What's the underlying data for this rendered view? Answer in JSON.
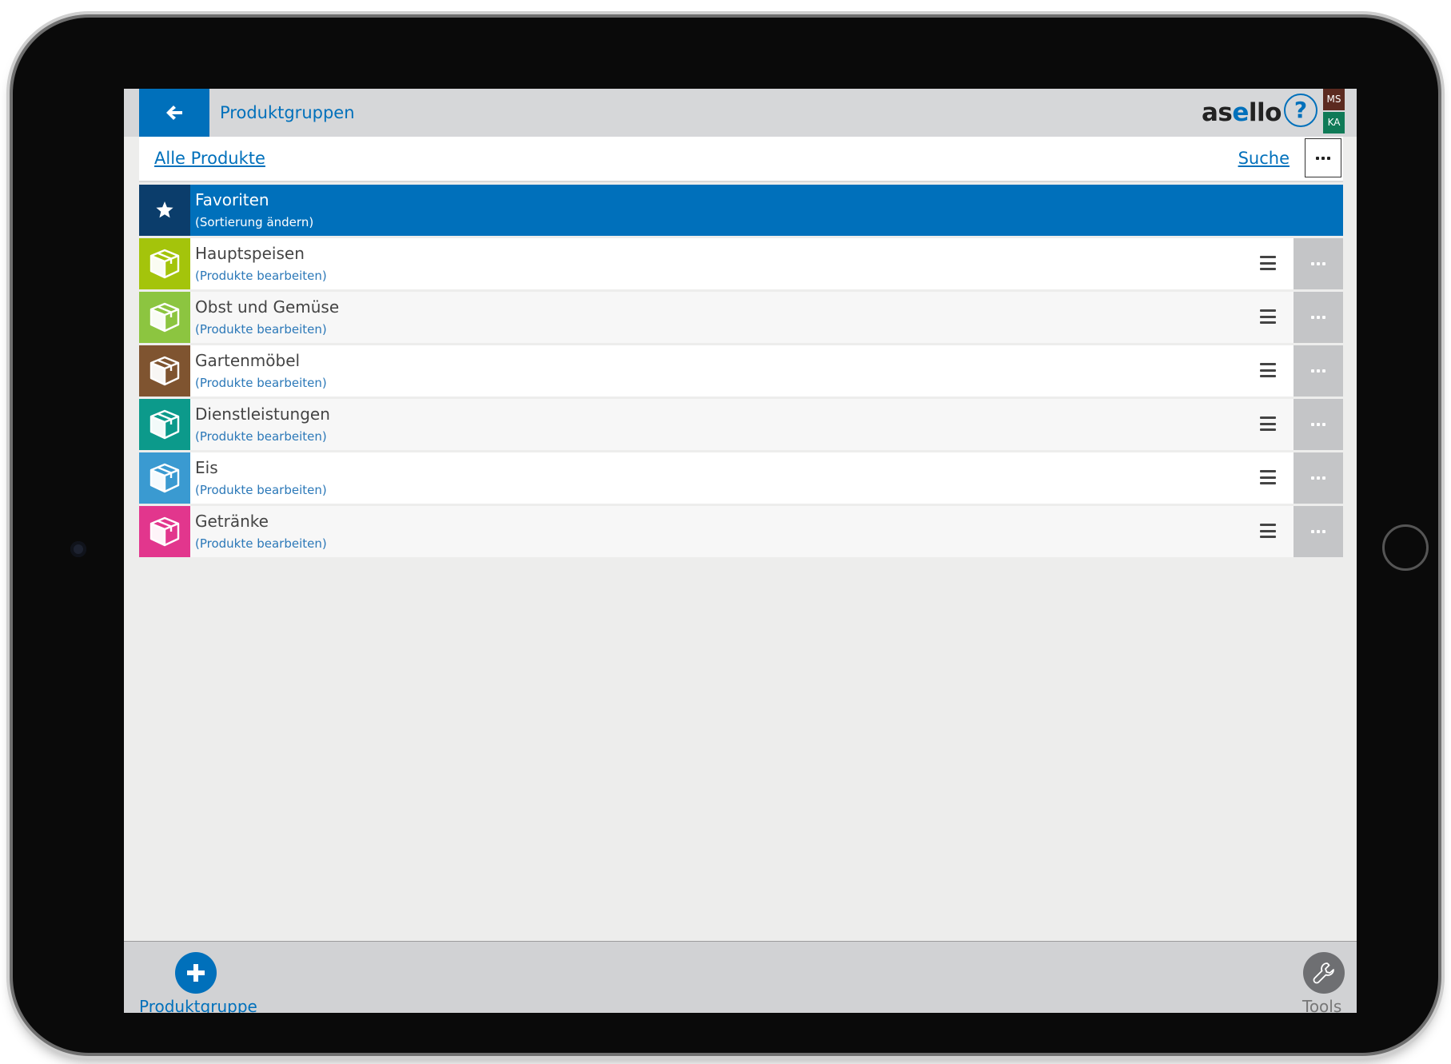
{
  "header": {
    "title": "Produktgruppen",
    "logo_text_a": "as",
    "logo_text_e": "e",
    "logo_text_b": "llo",
    "help_symbol": "?",
    "user_badges": [
      "MS",
      "KA"
    ]
  },
  "subbar": {
    "all_products_link": "Alle Produkte",
    "search_link": "Suche"
  },
  "favorites": {
    "name": "Favoriten",
    "sub": "(Sortierung ändern)",
    "icon": "star-icon",
    "icon_bg": "#0b3d6b"
  },
  "groups": [
    {
      "name": "Hauptspeisen",
      "sub": "(Produkte bearbeiten)",
      "color": "#a4c40b"
    },
    {
      "name": "Obst und Gemüse",
      "sub": "(Produkte bearbeiten)",
      "color": "#8cc540"
    },
    {
      "name": "Gartenmöbel",
      "sub": "(Produkte bearbeiten)",
      "color": "#7f5430"
    },
    {
      "name": "Dienstleistungen",
      "sub": "(Produkte bearbeiten)",
      "color": "#0c9a8b"
    },
    {
      "name": "Eis",
      "sub": "(Produkte bearbeiten)",
      "color": "#3a9ad1"
    },
    {
      "name": "Getränke",
      "sub": "(Produkte bearbeiten)",
      "color": "#e2368d"
    }
  ],
  "footer": {
    "add_label": "Produktgruppe",
    "tools_label": "Tools"
  },
  "colors": {
    "accent": "#0070bb",
    "user_badge_ms": "#5b2a20",
    "user_badge_ka": "#0f7a57"
  }
}
